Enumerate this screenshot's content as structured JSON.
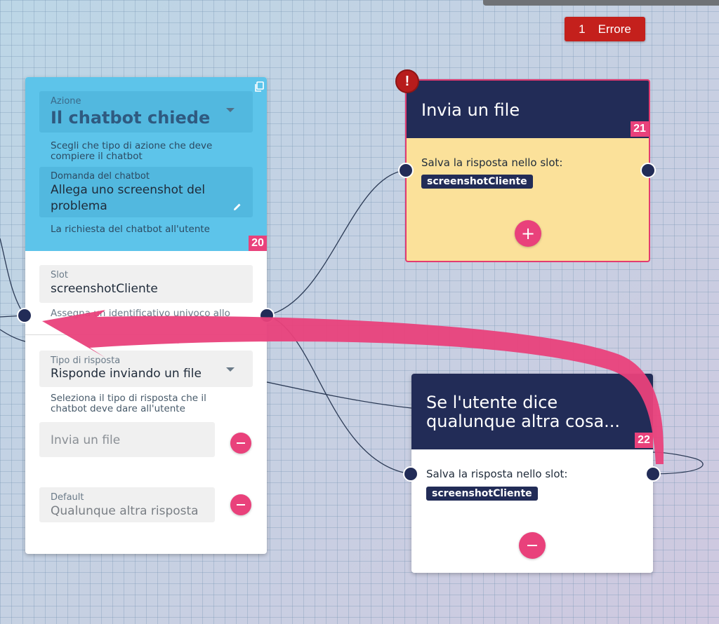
{
  "error_badge": {
    "count": "1",
    "label": "Errore"
  },
  "card20": {
    "action_label": "Azione",
    "action_value": "Il chatbot chiede",
    "action_helper": "Scegli che tipo di azione che deve compiere il chatbot",
    "question_label": "Domanda del chatbot",
    "question_value": "Allega uno screenshot del problema",
    "question_helper": "La richiesta del chatbot all'utente",
    "id": "20",
    "slot_label": "Slot",
    "slot_value": "screenshotCliente",
    "slot_helper": "Assegna un identificativo univoco allo",
    "response_type_label": "Tipo di risposta",
    "response_type_value": "Risponde inviando un file",
    "response_type_helper": "Seleziona il tipo di risposta che il chatbot deve dare all'utente",
    "option1_value": "Invia un file",
    "option2_label": "Default",
    "option2_value": "Qualunque altra risposta"
  },
  "card21": {
    "title": "Invia un file",
    "id": "21",
    "slot_text": "Salva la risposta nello slot:",
    "slot_chip": "screenshotCliente",
    "warning": "!"
  },
  "card22": {
    "title_line1": "Se l'utente dice",
    "title_line2": "qualunque altra cosa...",
    "id": "22",
    "slot_text": "Salva la risposta nello slot:",
    "slot_chip": "screenshotCliente"
  },
  "colors": {
    "accent_pink": "#e9417b",
    "navy": "#222c57",
    "card_blue": "#5dc4ea",
    "file_yellow": "#fbe19a",
    "error_red": "#c4201c"
  }
}
